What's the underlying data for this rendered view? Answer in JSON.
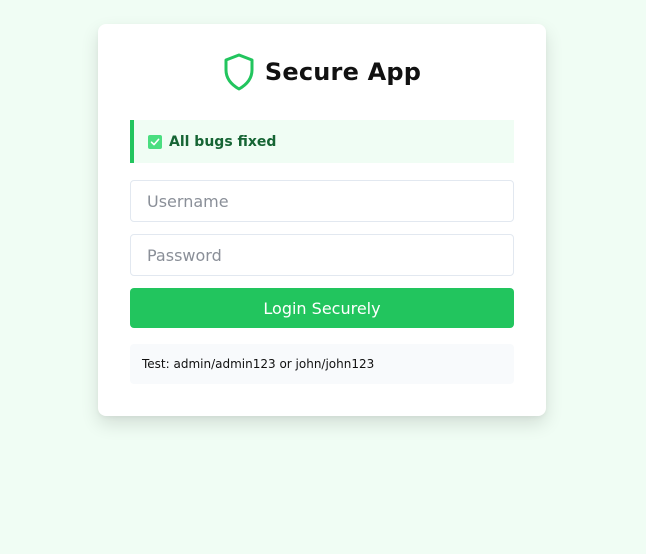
{
  "app": {
    "title": "Secure App",
    "logo_icon": "shield-icon",
    "accent_color": "#22c55e"
  },
  "alert": {
    "icon": "checkbox-check-icon",
    "text": "All bugs fixed"
  },
  "form": {
    "username_placeholder": "Username",
    "password_placeholder": "Password",
    "username_value": "",
    "password_value": "",
    "submit_label": "Login Securely"
  },
  "hint": {
    "text": "Test: admin/admin123 or john/john123"
  }
}
